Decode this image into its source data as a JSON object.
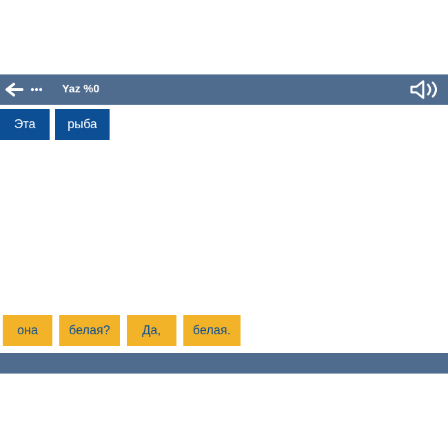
{
  "header": {
    "title": "Yaz %0"
  },
  "answer": {
    "words": [
      "Эта",
      "рыба"
    ]
  },
  "bank": {
    "words": [
      "она",
      "белая?",
      "Да,",
      "белая."
    ]
  }
}
